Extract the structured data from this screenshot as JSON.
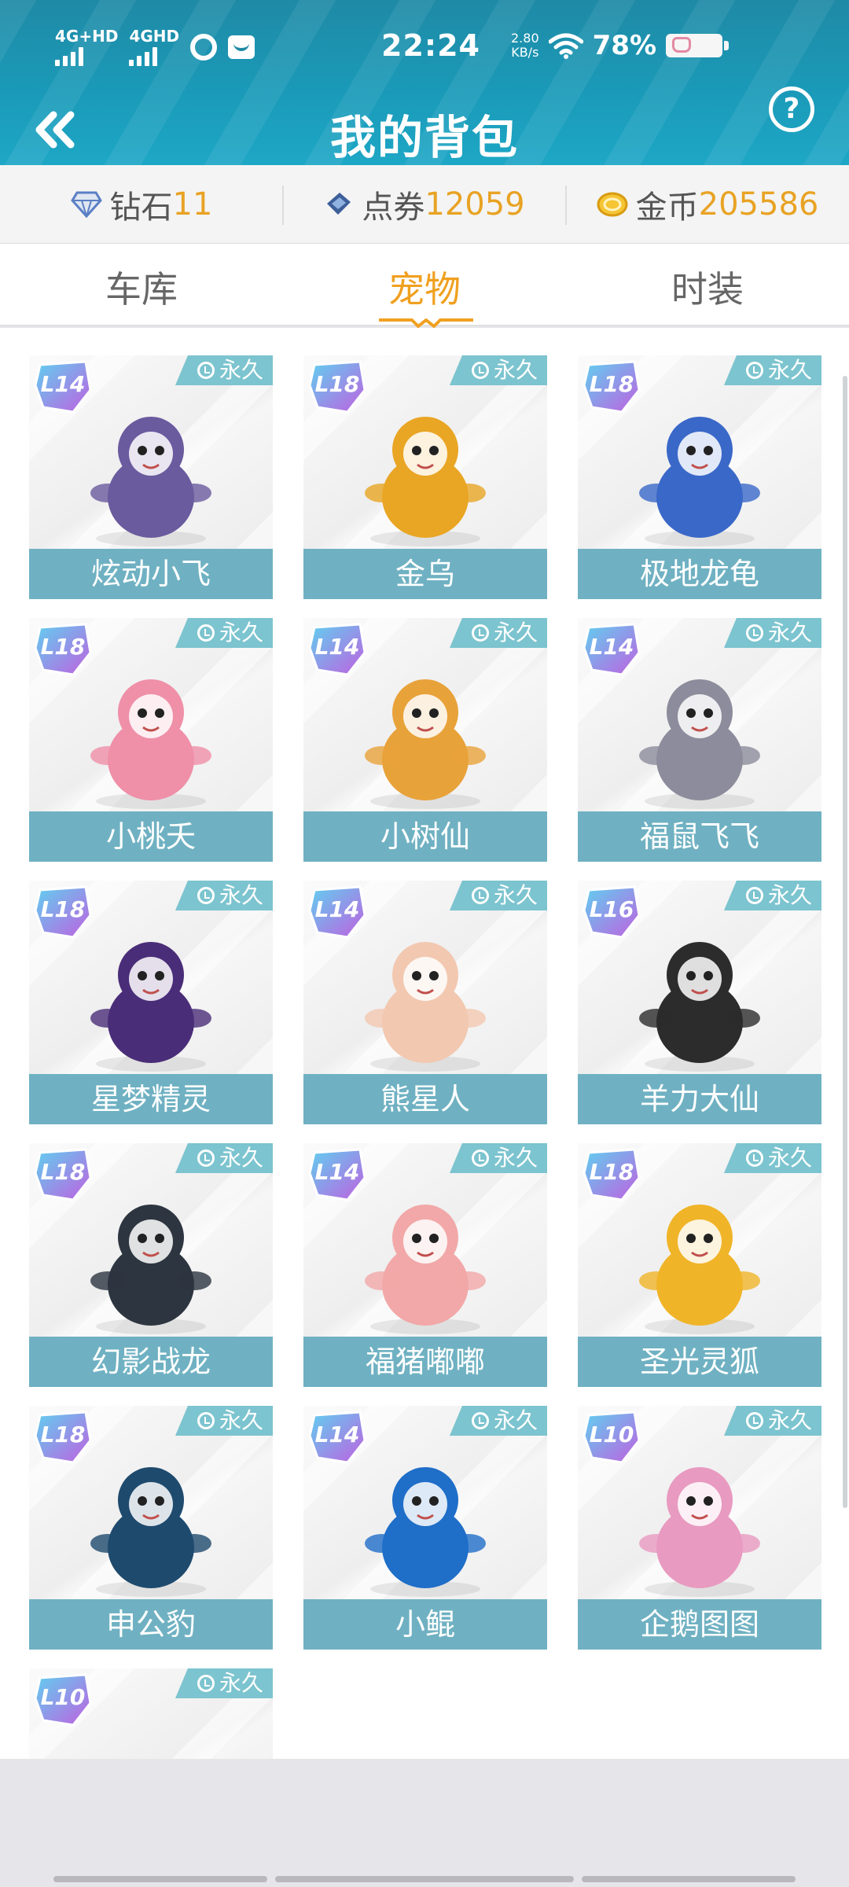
{
  "status_bar": {
    "net1": "4G+HD",
    "net2": "4GHD",
    "time": "22:24",
    "speed_value": "2.80",
    "speed_unit": "KB/s",
    "battery": "78%"
  },
  "header": {
    "title": "我的背包",
    "help": "?"
  },
  "currency": {
    "diamond_label": "钻石",
    "diamond_value": "11",
    "coupon_label": "点券",
    "coupon_value": "12059",
    "gold_label": "金币",
    "gold_value": "205586"
  },
  "tabs": {
    "garage": "车库",
    "pets": "宠物",
    "fashion": "时装"
  },
  "pets": [
    {
      "name": "炫动小飞",
      "level": "14",
      "tag": "永久",
      "art": "penguin",
      "color": "#6a5a9e"
    },
    {
      "name": "金乌",
      "level": "18",
      "tag": "永久",
      "art": "phoenix",
      "color": "#e9a524"
    },
    {
      "name": "极地龙龟",
      "level": "18",
      "tag": "永久",
      "art": "dragon-turtle",
      "color": "#3a68c8"
    },
    {
      "name": "小桃夭",
      "level": "18",
      "tag": "永久",
      "art": "peach-girl",
      "color": "#ef8fa8"
    },
    {
      "name": "小树仙",
      "level": "14",
      "tag": "永久",
      "art": "tree",
      "color": "#e8a23a"
    },
    {
      "name": "福鼠飞飞",
      "level": "14",
      "tag": "永久",
      "art": "mouse",
      "color": "#8c8c9c"
    },
    {
      "name": "星梦精灵",
      "level": "18",
      "tag": "永久",
      "art": "fairy",
      "color": "#4a2d78"
    },
    {
      "name": "熊星人",
      "level": "14",
      "tag": "永久",
      "art": "bear",
      "color": "#f2c8b0"
    },
    {
      "name": "羊力大仙",
      "level": "16",
      "tag": "永久",
      "art": "goat",
      "color": "#2c2c2c"
    },
    {
      "name": "幻影战龙",
      "level": "18",
      "tag": "永久",
      "art": "dark-dragon",
      "color": "#2d3540"
    },
    {
      "name": "福猪嘟嘟",
      "level": "14",
      "tag": "永久",
      "art": "pig",
      "color": "#f2a8a8"
    },
    {
      "name": "圣光灵狐",
      "level": "18",
      "tag": "永久",
      "art": "fox",
      "color": "#f0b428"
    },
    {
      "name": "申公豹",
      "level": "18",
      "tag": "永久",
      "art": "leopard",
      "color": "#1e4a6e"
    },
    {
      "name": "小鲲",
      "level": "14",
      "tag": "永久",
      "art": "whale",
      "color": "#1f6ec8"
    },
    {
      "name": "企鹅图图",
      "level": "10",
      "tag": "永久",
      "art": "pink-penguin",
      "color": "#e89ac0"
    },
    {
      "name": "",
      "level": "10",
      "tag": "永久",
      "art": "partial",
      "color": "#2a78c0"
    }
  ]
}
